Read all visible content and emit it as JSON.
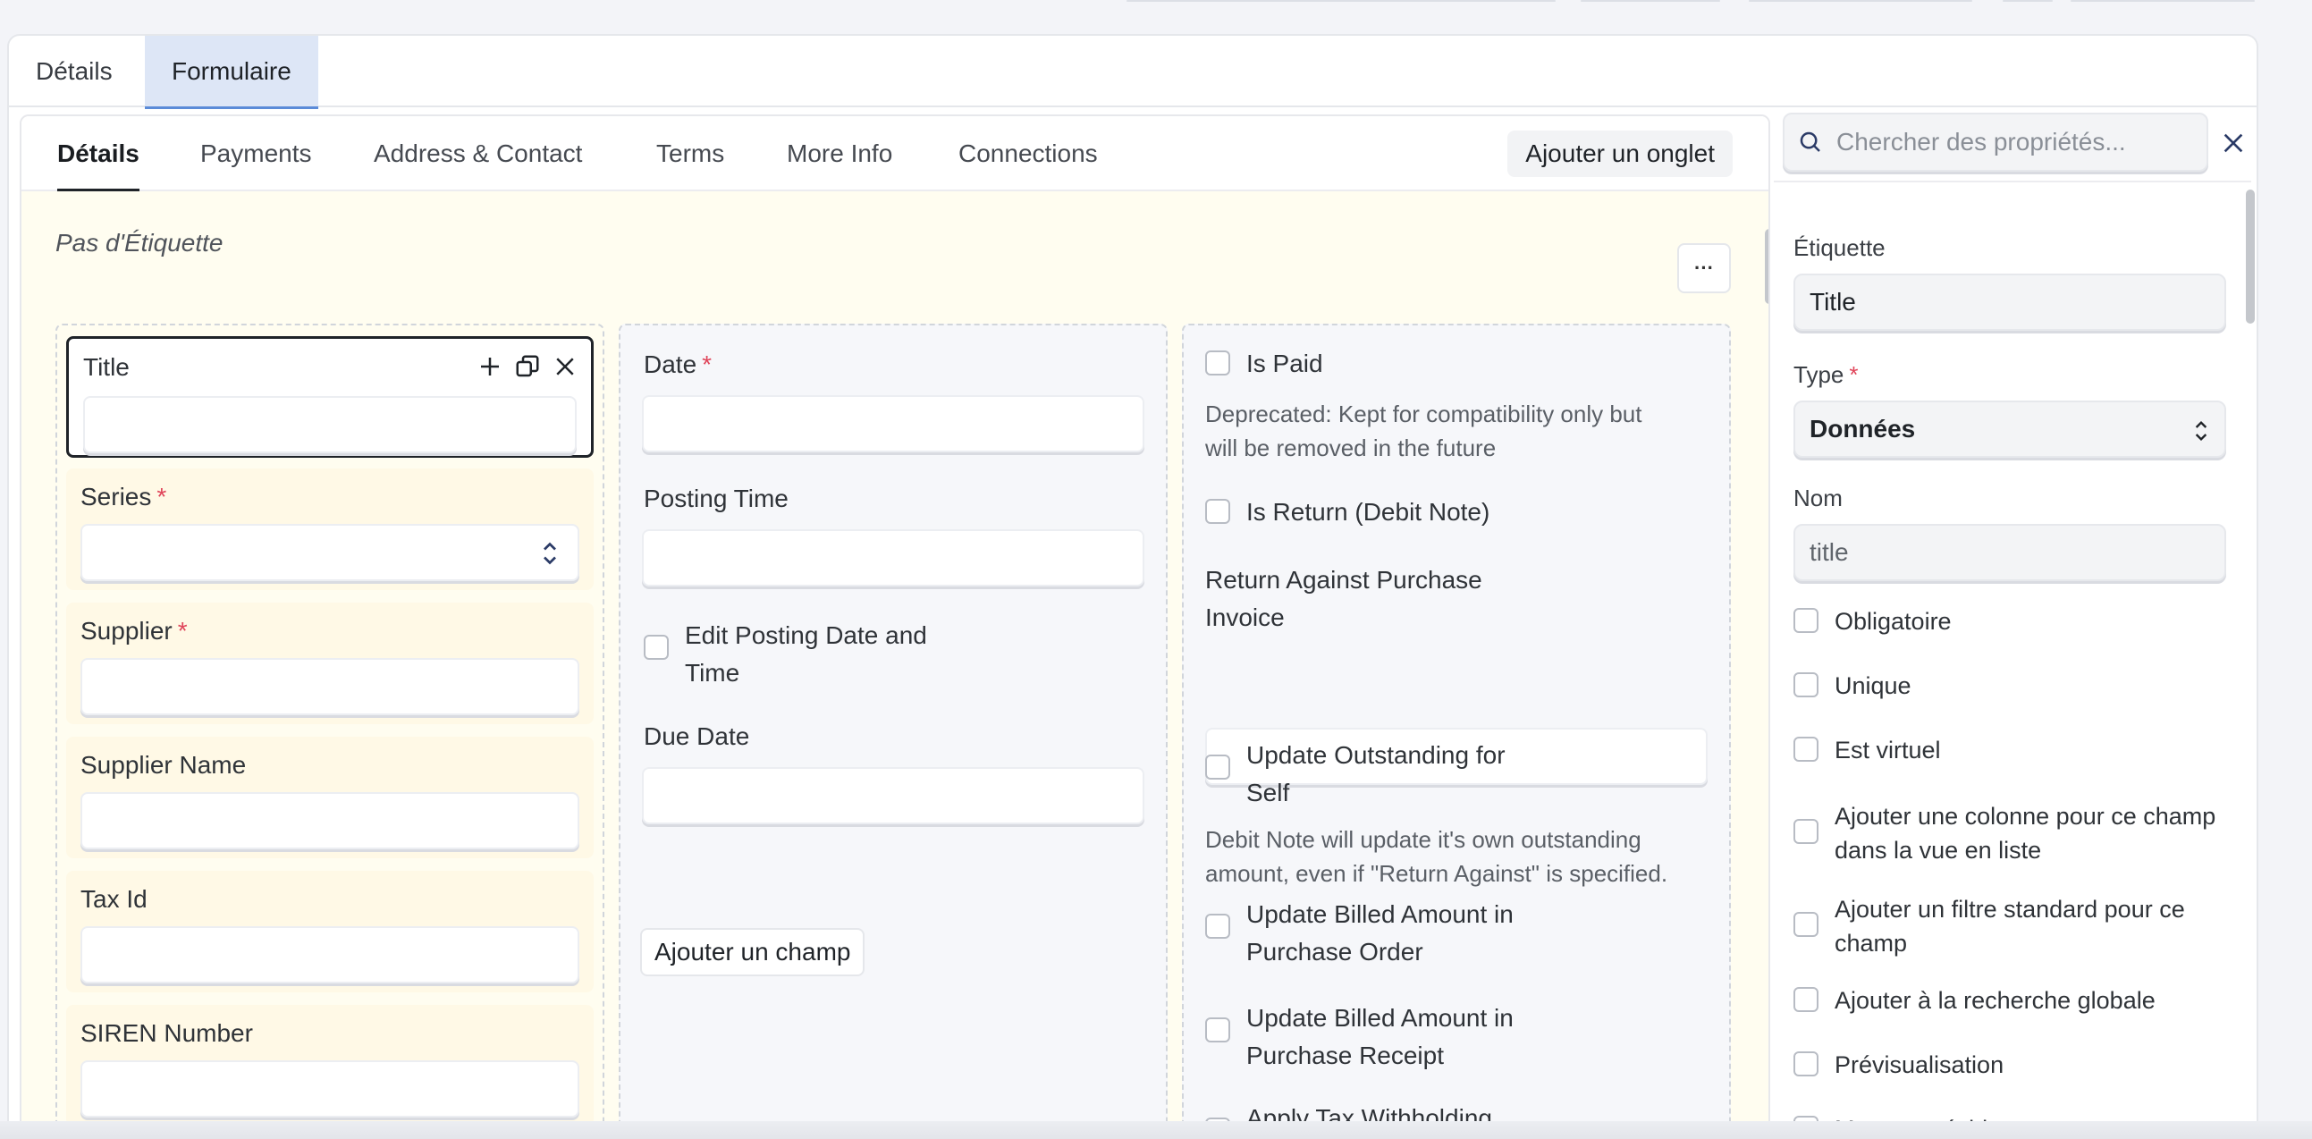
{
  "top_tabs": [
    "Détails",
    "Formulaire"
  ],
  "inner_tabs": [
    "Détails",
    "Payments",
    "Address & Contact",
    "Terms",
    "More Info",
    "Connections"
  ],
  "add_tab_label": "Ajouter un onglet",
  "section": {
    "title": "Pas d'Étiquette",
    "more_label": "···"
  },
  "column1": {
    "title_label": "Title",
    "series_label": "Series",
    "supplier_label": "Supplier",
    "supplier_name_label": "Supplier Name",
    "tax_id_label": "Tax Id",
    "siren_label": "SIREN Number",
    "required_mark": "*"
  },
  "column2": {
    "date_label": "Date",
    "posting_time_label": "Posting Time",
    "edit_posting_label_1": "Edit Posting Date and",
    "edit_posting_label_2": "Time",
    "due_date_label": "Due Date",
    "add_field_label": "Ajouter un champ"
  },
  "column3": {
    "is_paid_label": "Is Paid",
    "is_paid_desc_1": "Deprecated: Kept for compatibility only but",
    "is_paid_desc_2": "will be removed in the future",
    "is_return_label": "Is Return (Debit Note)",
    "return_against_1": "Return Against Purchase",
    "return_against_2": "Invoice",
    "update_outstanding_1": "Update Outstanding for",
    "update_outstanding_2": "Self",
    "update_outstanding_desc_1": "Debit Note will update it's own outstanding",
    "update_outstanding_desc_2": "amount, even if \"Return Against\" is specified.",
    "update_billed_po_1": "Update Billed Amount in",
    "update_billed_po_2": "Purchase Order",
    "update_billed_pr_1": "Update Billed Amount in",
    "update_billed_pr_2": "Purchase Receipt",
    "apply_tax_label": "Apply Tax Withholding"
  },
  "properties": {
    "search_placeholder": "Chercher des propriétés...",
    "label_label": "Étiquette",
    "label_value": "Title",
    "type_label": "Type",
    "type_value": "Données",
    "name_label": "Nom",
    "name_value": "title",
    "checks": [
      "Obligatoire",
      "Unique",
      "Est virtuel",
      "Ajouter une colonne pour ce champ dans la vue en liste",
      "Ajouter un filtre standard pour ce champ",
      "Ajouter à la recherche globale",
      "Prévisualisation",
      "Mettre en évidence"
    ]
  },
  "colors": {
    "accent": "#5b8bd8",
    "required": "#e0455a",
    "section_bg": "#fffdf0"
  }
}
